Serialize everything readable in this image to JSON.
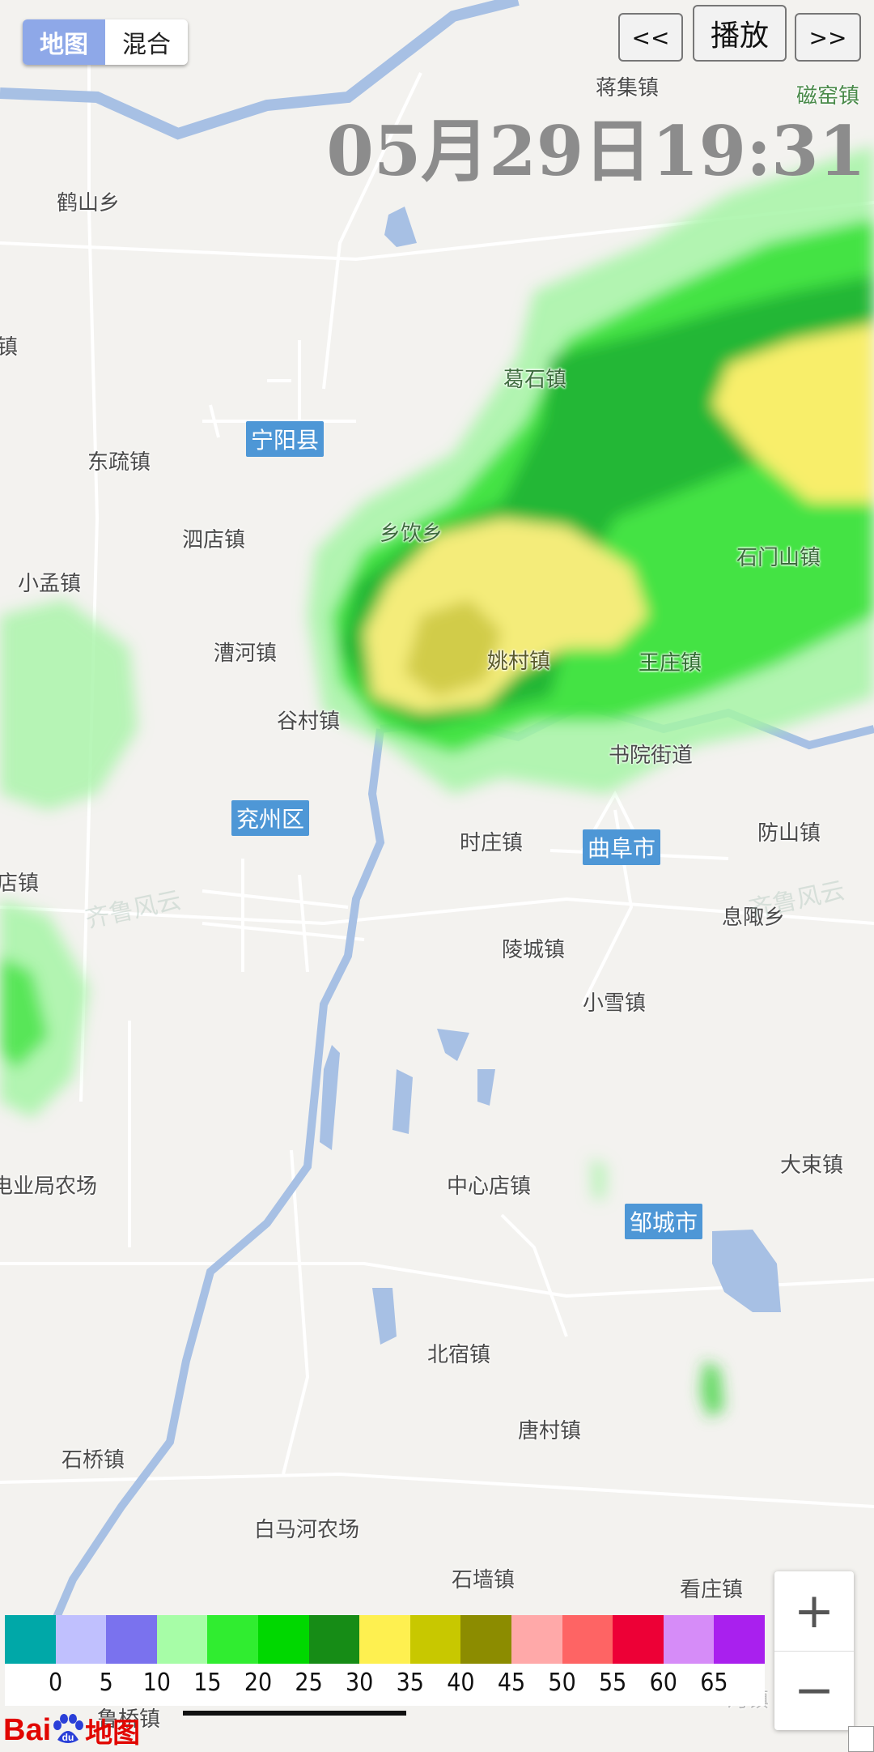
{
  "map_type": {
    "options": [
      "地图",
      "混合"
    ],
    "selected": "地图"
  },
  "playback": {
    "prev": "<<",
    "play": "播放",
    "next": ">>"
  },
  "timestamp": "05月29日19:31",
  "places": [
    "蒋集镇",
    "磁窑镇",
    "鹤山乡",
    "镇",
    "葛石镇",
    "东疏镇",
    "泗店镇",
    "乡饮乡",
    "小孟镇",
    "石门山镇",
    "漕河镇",
    "姚村镇",
    "王庄镇",
    "谷村镇",
    "书院街道",
    "时庄镇",
    "防山镇",
    "店镇",
    "息陬乡",
    "陵城镇",
    "小雪镇",
    "中心店镇",
    "大束镇",
    "电业局农场",
    "北宿镇",
    "唐村镇",
    "石桥镇",
    "白马河农场",
    "石墙镇",
    "看庄镇",
    "鲁桥镇",
    "河镇"
  ],
  "counties": [
    "宁阳县",
    "兖州区",
    "曲阜市",
    "邹城市"
  ],
  "watermark": "齐鲁风云",
  "legend": {
    "colors": [
      "#00a8a8",
      "#c0c0fe",
      "#7a72ee",
      "#a7fda7",
      "#30ed30",
      "#00d800",
      "#168c16",
      "#fef050",
      "#c8c800",
      "#8c8c00",
      "#ffa9a9",
      "#fe6464",
      "#ed0036",
      "#d68cf8",
      "#a920ee"
    ],
    "labels": [
      "0",
      "5",
      "10",
      "15",
      "20",
      "25",
      "30",
      "35",
      "40",
      "45",
      "50",
      "55",
      "60",
      "65"
    ]
  },
  "zoom": {
    "in": "+",
    "out": "−"
  },
  "logo": {
    "brand": "Bai",
    "suffix": "地图"
  }
}
